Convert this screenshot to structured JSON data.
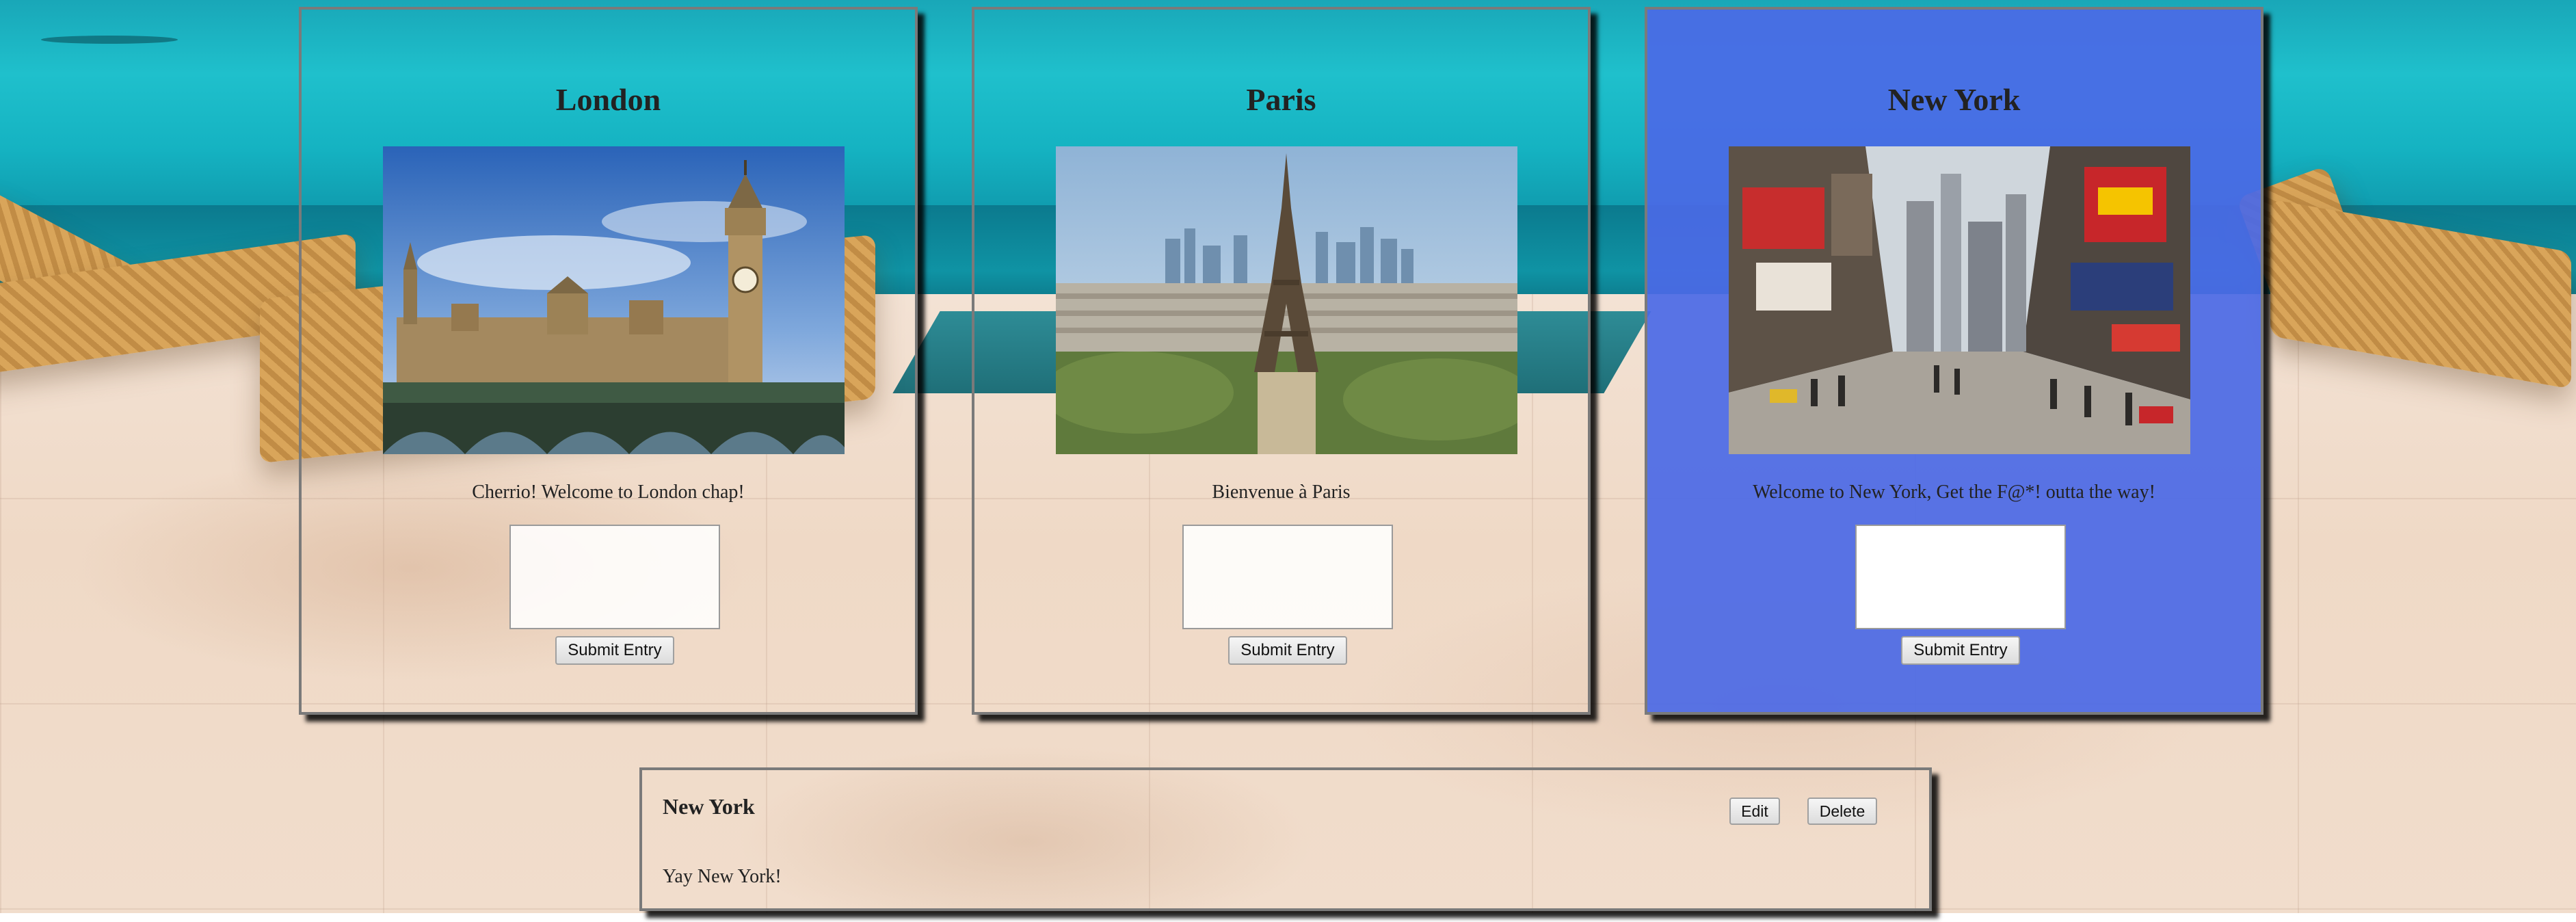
{
  "cities": [
    {
      "id": "london",
      "title": "London",
      "greeting": "Cherrio! Welcome to London chap!",
      "submit_label": "Submit Entry",
      "image_alt": "Houses of Parliament and Big Ben"
    },
    {
      "id": "paris",
      "title": "Paris",
      "greeting": "Bienvenue à Paris",
      "submit_label": "Submit Entry",
      "image_alt": "Eiffel Tower and La Défense skyline"
    },
    {
      "id": "newyork",
      "title": "New York",
      "greeting": "Welcome to New York, Get the F@*! outta the way!",
      "submit_label": "Submit Entry",
      "image_alt": "Times Square billboards and crowds"
    }
  ],
  "entry": {
    "city": "New York",
    "text": "Yay New York!",
    "edit_label": "Edit",
    "delete_label": "Delete"
  },
  "colors": {
    "selected_panel": "#4b69e6",
    "panel_border": "#7a7a7a",
    "background_sea": "#1fc0cc",
    "background_deck": "#f1ddcc"
  },
  "icons": {
    "london_photo": "london-landmark-photo",
    "paris_photo": "paris-landmark-photo",
    "newyork_photo": "newyork-street-photo"
  }
}
